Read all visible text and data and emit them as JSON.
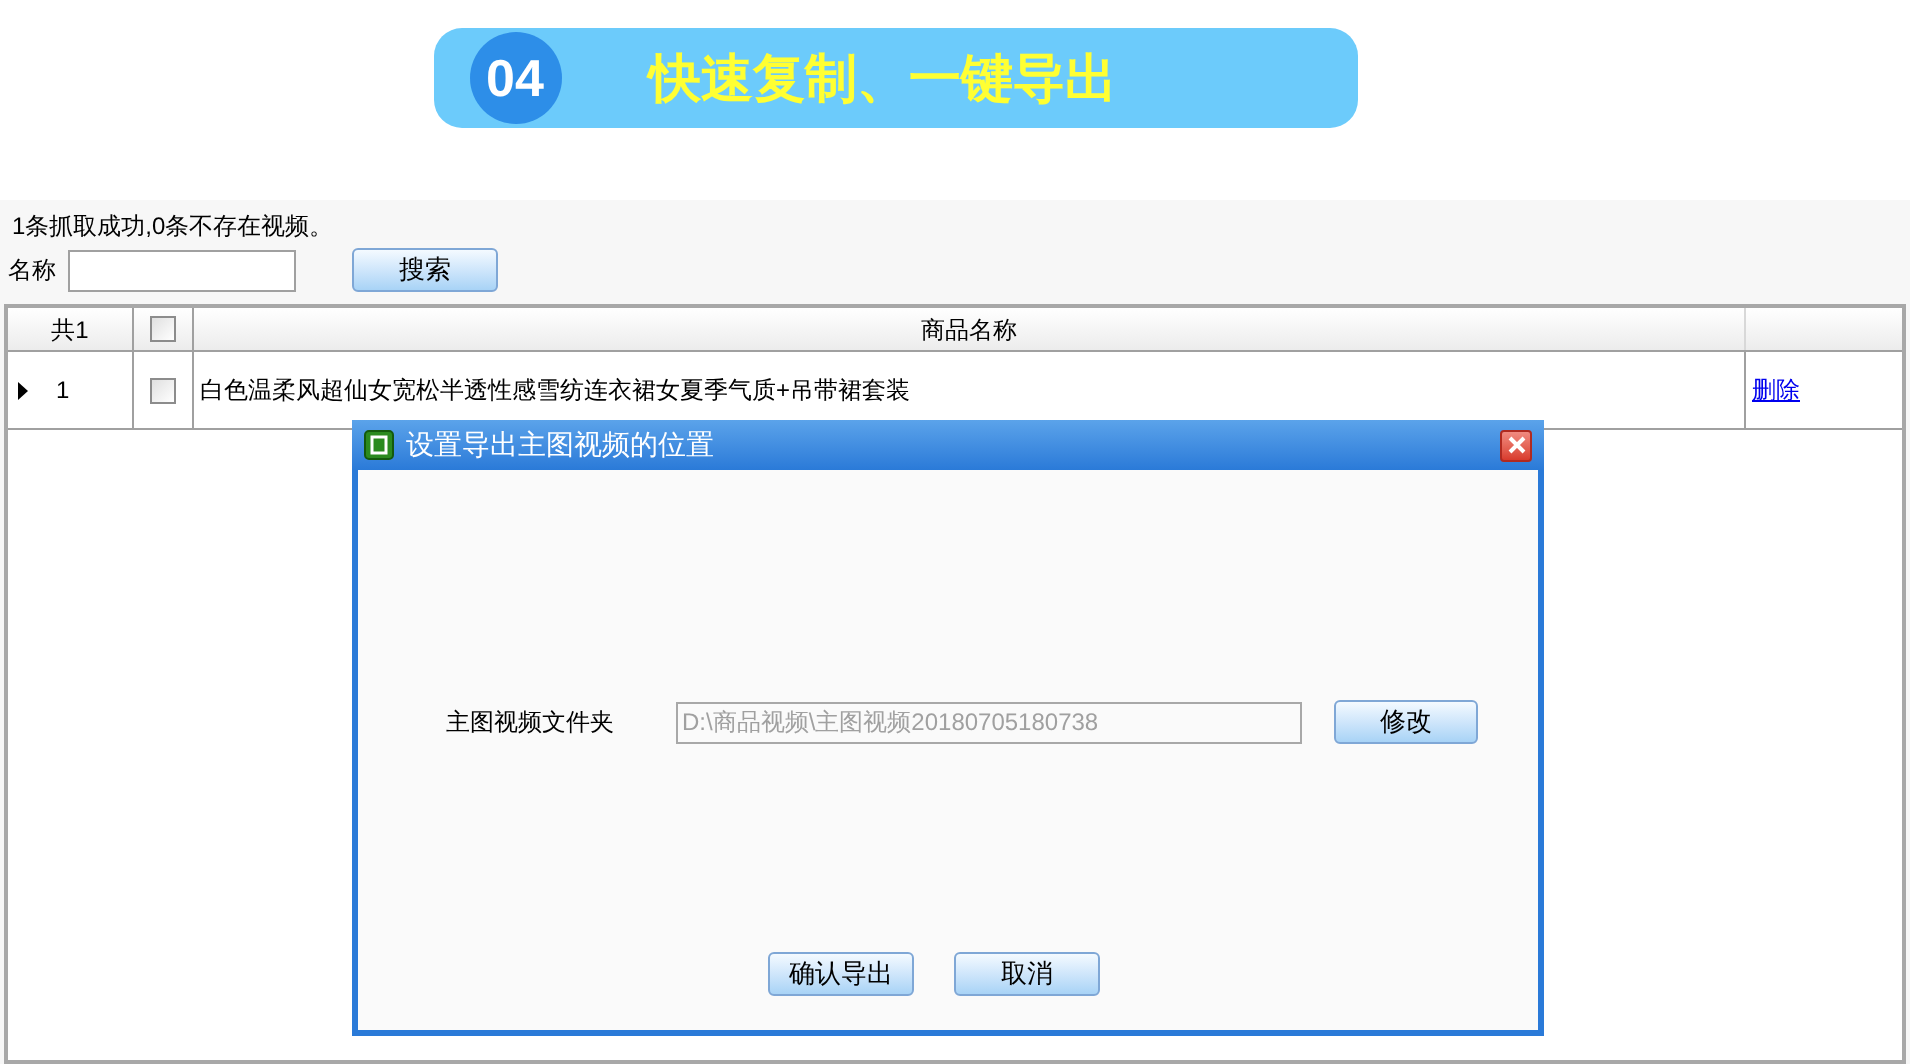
{
  "banner": {
    "number": "04",
    "title": "快速复制、一键导出"
  },
  "status": "1条抓取成功,0条不存在视频。",
  "search": {
    "label": "名称",
    "button": "搜索"
  },
  "table": {
    "count_header": "共1",
    "select_all": {
      "checked": false
    },
    "columns": [
      "商品名称"
    ],
    "rows": [
      {
        "current": true,
        "index": "1",
        "checked": false,
        "name": "白色温柔风超仙女宽松半透性感雪纺连衣裙女夏季气质+吊带裙套装",
        "action": "删除"
      }
    ]
  },
  "dialog": {
    "title": "设置导出主图视频的位置",
    "folder_label": "主图视频文件夹",
    "folder_value": "D:\\商品视频\\主图视频20180705180738",
    "folder_disabled": true,
    "change_button": "修改",
    "buttons": [
      "确认导出",
      "取消"
    ]
  }
}
